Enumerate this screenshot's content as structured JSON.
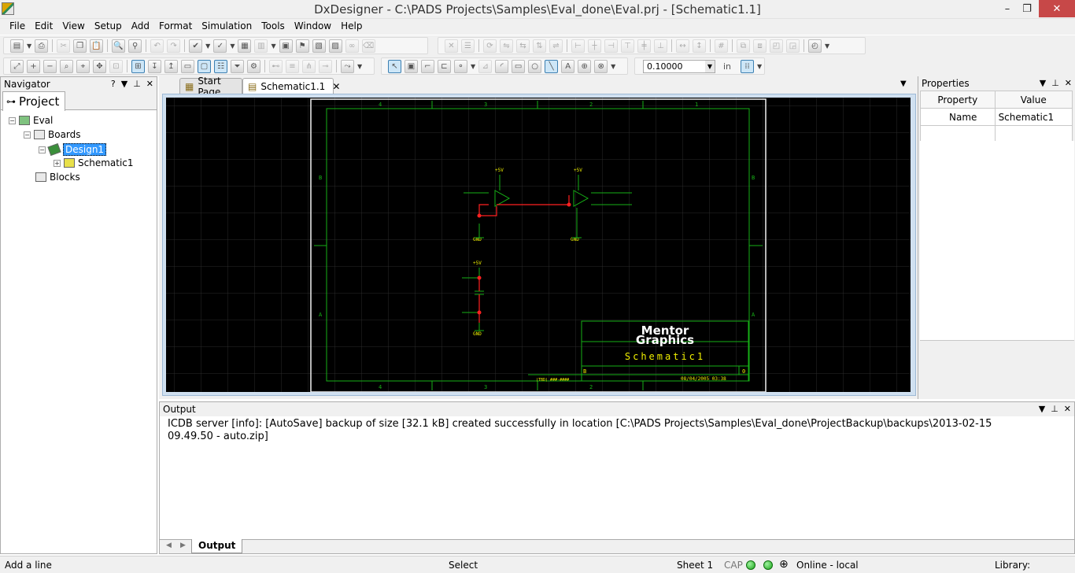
{
  "window": {
    "title": "DxDesigner - C:\\PADS Projects\\Samples\\Eval_done\\Eval.prj - [Schematic1.1]",
    "minimize": "–",
    "restore": "❐",
    "close": "✕"
  },
  "menubar": [
    "File",
    "Edit",
    "View",
    "Setup",
    "Add",
    "Format",
    "Simulation",
    "Tools",
    "Window",
    "Help"
  ],
  "toolbar": {
    "grid_value": "0.10000",
    "unit": "in"
  },
  "navigator": {
    "title": "Navigator",
    "tab": "Project",
    "tree": {
      "root": "Eval",
      "boards": "Boards",
      "design": "Design1",
      "schematic": "Schematic1",
      "blocks": "Blocks"
    }
  },
  "document": {
    "tabs": [
      "Start Page",
      "Schematic1.1"
    ],
    "active_tab": "Schematic1.1"
  },
  "schematic": {
    "logo_line1": "Mentor",
    "logo_line2": "Graphics",
    "sheet_title": "Schematic1",
    "rev": "B",
    "sheet_no": "0",
    "date": "08/04/2005 03:38",
    "drawing_no": "(TBD) ###-####",
    "col_labels": [
      "4",
      "3",
      "2",
      "1"
    ],
    "row_labels": [
      "B",
      "A"
    ],
    "net_labels": [
      "+5V",
      "GND"
    ]
  },
  "properties": {
    "title": "Properties",
    "headers": [
      "Property",
      "Value"
    ],
    "rows": [
      {
        "property": "Name",
        "value": "Schematic1"
      }
    ]
  },
  "output": {
    "title": "Output",
    "message": "ICDB server [info]: [AutoSave] backup of size [32.1 kB] created successfully in location [C:\\PADS Projects\\Samples\\Eval_done\\ProjectBackup\\backups\\2013-02-15\n09.49.50 - auto.zip]",
    "tab": "Output"
  },
  "status": {
    "hint": "Add a line",
    "mode": "Select",
    "sheet": "Sheet 1",
    "cap": "CAP",
    "online": "Online - local",
    "library": "Library:"
  }
}
